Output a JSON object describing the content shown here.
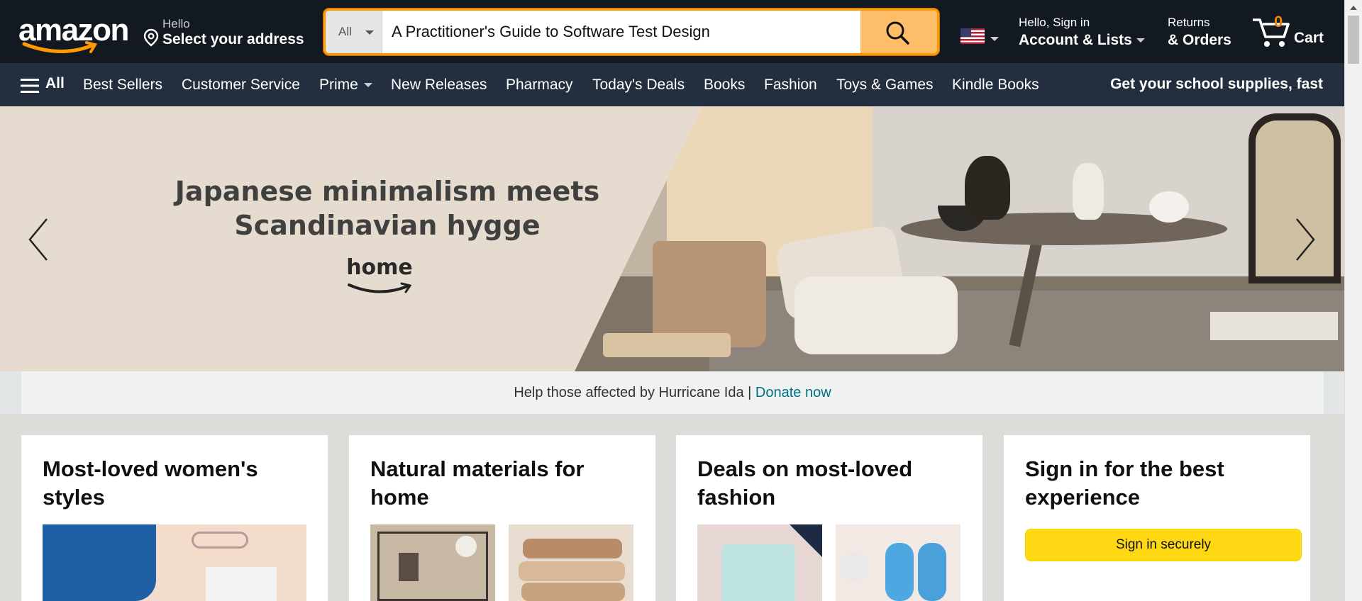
{
  "header": {
    "logo_text": "amazon",
    "address": {
      "hello": "Hello",
      "select": "Select your address"
    },
    "search": {
      "category": "All",
      "value": "A Practitioner's Guide to Software Test Design"
    },
    "account": {
      "line1": "Hello, Sign in",
      "line2": "Account & Lists"
    },
    "orders": {
      "line1": "Returns",
      "line2": "& Orders"
    },
    "cart": {
      "count": "0",
      "label": "Cart"
    }
  },
  "subnav": {
    "all": "All",
    "items": [
      "Best Sellers",
      "Customer Service",
      "Prime",
      "New Releases",
      "Pharmacy",
      "Today's Deals",
      "Books",
      "Fashion",
      "Toys & Games",
      "Kindle Books"
    ],
    "promo": "Get your school supplies, fast"
  },
  "hero": {
    "title_line1": "Japanese minimalism meets",
    "title_line2": "Scandinavian hygge",
    "brand": "home"
  },
  "donation": {
    "text": "Help those affected by Hurricane Ida | ",
    "link": "Donate now"
  },
  "cards": [
    {
      "title": "Most-loved women's styles"
    },
    {
      "title": "Natural materials for home"
    },
    {
      "title": "Deals on most-loved fashion"
    },
    {
      "title": "Sign in for the best experience",
      "button": "Sign in securely"
    }
  ],
  "colors": {
    "nav_top": "#131921",
    "nav_sub": "#232f3e",
    "search_button": "#febd69",
    "accent": "#ff9900",
    "signin_button": "#ffd814",
    "link": "#007185"
  },
  "icons": [
    "location-pin-icon",
    "search-icon",
    "us-flag-icon",
    "cart-icon",
    "hamburger-icon",
    "chevron-left-icon",
    "chevron-right-icon"
  ]
}
